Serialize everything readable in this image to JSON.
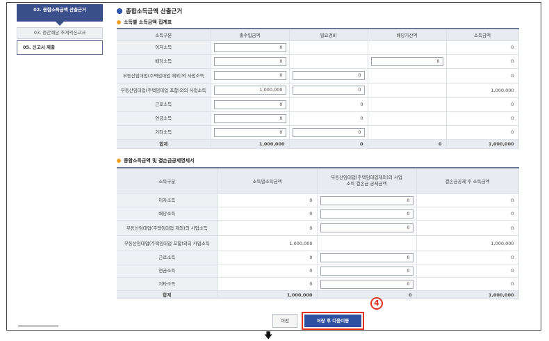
{
  "sidebar": {
    "items": [
      {
        "label": "02. 종합소득금액 산출근거"
      },
      {
        "label": "03. 중간예납 추계액신고서"
      },
      {
        "label": "05. 신고서 제출"
      }
    ]
  },
  "main": {
    "title": "종합소득금액 산출근거",
    "section1": {
      "title": "소득별 소득금액 집계표",
      "headers": [
        "소득구분",
        "총수입금액",
        "필요경비",
        "배당가산액",
        "소득금액"
      ],
      "rows": [
        {
          "label": "이자소득",
          "c1": "0",
          "c2": "",
          "c3": "",
          "c4": "0"
        },
        {
          "label": "배당소득",
          "c1": "0",
          "c2": "",
          "c3": "0",
          "c4": "0"
        },
        {
          "label": "부동산임대업(주택임대업 제외)의 사업소득",
          "c1": "0",
          "c2": "0",
          "c3": "",
          "c4": "0"
        },
        {
          "label": "부동산임대업(주택임대업 포함)외의 사업소득",
          "c1": "1,000,000",
          "c2": "0",
          "c3": "",
          "c4": "1,000,000"
        },
        {
          "label": "근로소득",
          "c1": "0",
          "c2": "0",
          "c3": "",
          "c4": "0"
        },
        {
          "label": "연금소득",
          "c1": "0",
          "c2": "0",
          "c3": "",
          "c4": "0"
        },
        {
          "label": "기타소득",
          "c1": "0",
          "c2": "0",
          "c3": "",
          "c4": "0"
        }
      ],
      "total": {
        "label": "합계",
        "c1": "1,000,000",
        "c2": "0",
        "c3": "0",
        "c4": "1,000,000"
      }
    },
    "section2": {
      "title": "종합소득금액 및 결손금공제명세서",
      "headers": [
        "소득구분",
        "소득별소득금액",
        "부동산임대업(주택임대업제외)의 사업소득 결손금 공제금액",
        "결손금공제 후 소득금액"
      ],
      "rows": [
        {
          "label": "이자소득",
          "c1": "0",
          "c2": "0",
          "c3": "0"
        },
        {
          "label": "배당소득",
          "c1": "0",
          "c2": "0",
          "c3": "0"
        },
        {
          "label": "부동산임대업(주택임대업 제외)의 사업소득",
          "c1": "0",
          "c2": "0",
          "c3": "0"
        },
        {
          "label": "부동산임대업(주택임대업 포함)외의 사업소득",
          "c1": "1,000,000",
          "c2": "",
          "c3": "1,000,000"
        },
        {
          "label": "근로소득",
          "c1": "0",
          "c2": "0",
          "c3": "0"
        },
        {
          "label": "연금소득",
          "c1": "0",
          "c2": "0",
          "c3": "0"
        },
        {
          "label": "기타소득",
          "c1": "0",
          "c2": "0",
          "c3": "0"
        }
      ],
      "total": {
        "label": "합계",
        "c1": "1,000,000",
        "c2": "0",
        "c3": "1,000,000"
      }
    }
  },
  "buttons": {
    "prev": "이전",
    "next": "저장 후 다음이동"
  },
  "annotation": {
    "badge": "4"
  },
  "colors": {
    "primary": "#2f4fa0",
    "highlight": "#e03020",
    "section_dot": "#f0a020"
  },
  "icons": {
    "down": "down-arrow-icon"
  }
}
